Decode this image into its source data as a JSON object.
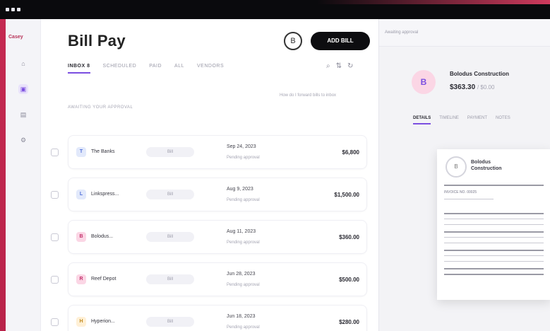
{
  "app": {
    "brand": "Casey",
    "title": "Bill Pay",
    "info_button": "B",
    "primary_button": "ADD BILL"
  },
  "tabs": [
    {
      "label": "INBOX",
      "count": "8",
      "active": true
    },
    {
      "label": "SCHEDULED"
    },
    {
      "label": "PAID"
    },
    {
      "label": "ALL"
    },
    {
      "label": "VENDORS"
    }
  ],
  "hint": "How do I forward bills to inbox",
  "section_label": "AWAITING YOUR APPROVAL",
  "rows": [
    {
      "initial": "T",
      "name": "The Banks",
      "status": "Bill",
      "date": "Sep 24, 2023",
      "sub": "Pending approval",
      "amount": "$6,800",
      "color": "#e2e9fb",
      "ink": "#4f6ed8"
    },
    {
      "initial": "L",
      "name": "Linkspress...",
      "status": "Bill",
      "date": "Aug 9, 2023",
      "sub": "Pending approval",
      "amount": "$1,500.00",
      "color": "#e2e9fb",
      "ink": "#4f6ed8"
    },
    {
      "initial": "B",
      "name": "Bolodus...",
      "status": "Bill",
      "date": "Aug 11, 2023",
      "sub": "Pending approval",
      "amount": "$360.00",
      "color": "#fbd6e5",
      "ink": "#c2306a"
    },
    {
      "initial": "R",
      "name": "Reef Depot",
      "status": "Bill",
      "date": "Jun 28, 2023",
      "sub": "Pending approval",
      "amount": "$500.00",
      "color": "#fbd6e5",
      "ink": "#c2306a"
    },
    {
      "initial": "H",
      "name": "Hyperion...",
      "status": "Bill",
      "date": "Jun 18, 2023",
      "sub": "Pending approval",
      "amount": "$280.00",
      "color": "#fff0d6",
      "ink": "#c28a1e"
    }
  ],
  "detail": {
    "crumb": "Awaiting approval",
    "avatar_initial": "B",
    "company": "Bolodus Construction",
    "amount": "$363.30",
    "amount_of": "/ $0.00",
    "tabs": [
      "DETAILS",
      "TIMELINE",
      "PAYMENT",
      "NOTES"
    ],
    "doc_logo": "B",
    "doc_title_1": "Bolodus",
    "doc_title_2": "Construction",
    "doc_sub": "INVOICE NO. 00025"
  }
}
